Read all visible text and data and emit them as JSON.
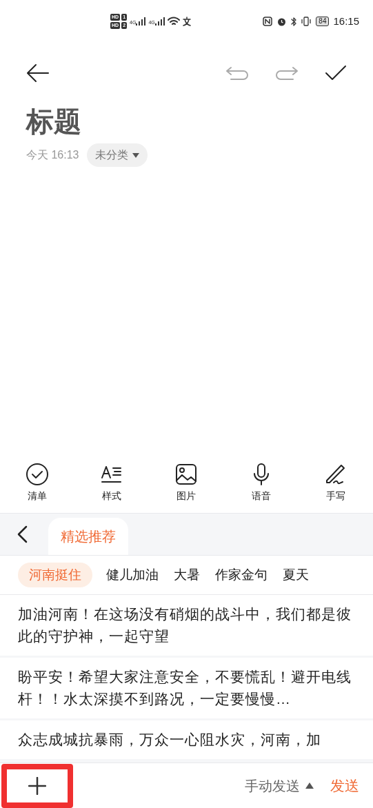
{
  "status_bar": {
    "sims": [
      {
        "badge": "HD",
        "slot": "1",
        "network": "4G"
      },
      {
        "badge": "HD",
        "slot": "2",
        "network": "4G"
      }
    ],
    "battery": "84",
    "time": "16:15"
  },
  "note": {
    "title": "标题",
    "date": "今天 16:13",
    "category": "未分类"
  },
  "toolbar": [
    {
      "kind": "checklist",
      "label": "清单"
    },
    {
      "kind": "style",
      "label": "样式"
    },
    {
      "kind": "image",
      "label": "图片"
    },
    {
      "kind": "voice",
      "label": "语音"
    },
    {
      "kind": "handwrite",
      "label": "手写"
    }
  ],
  "panel": {
    "tab": {
      "label": "精选推荐",
      "selected": true
    },
    "chips": [
      {
        "label": "河南挺住",
        "selected": true
      },
      {
        "label": "健儿加油",
        "selected": false
      },
      {
        "label": "大暑",
        "selected": false
      },
      {
        "label": "作家金句",
        "selected": false
      },
      {
        "label": "夏天",
        "selected": false
      }
    ],
    "phrases": [
      "加油河南！在这场没有硝烟的战斗中，我们都是彼此的守护神，一起守望",
      "盼平安！希望大家注意安全，不要慌乱！避开电线杆！！水太深摸不到路况，一定要慢慢…",
      "众志成城抗暴雨，万众一心阻水灾，河南，加"
    ]
  },
  "bottom_bar": {
    "mode": "手动发送",
    "send": "发送"
  }
}
